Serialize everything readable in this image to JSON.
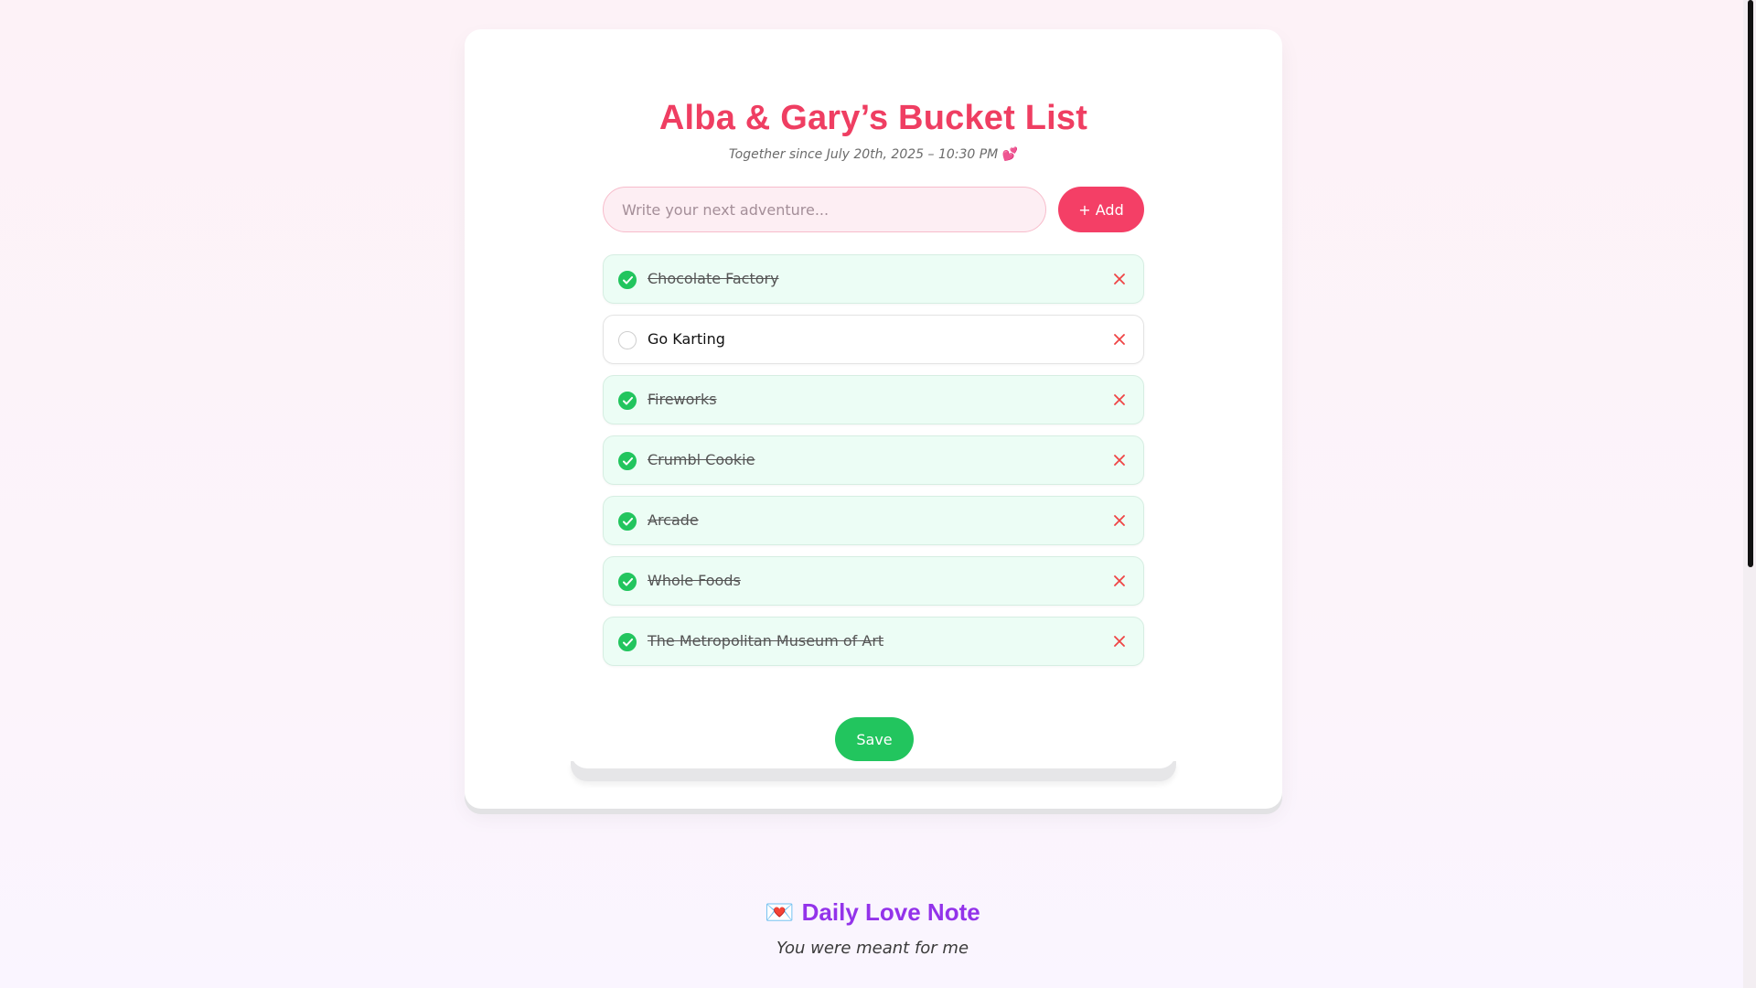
{
  "header": {
    "title": "Alba & Gary’s Bucket List",
    "subtitle": "Together since July 20th, 2025 – 10:30 PM",
    "subtitle_emoji": "💕"
  },
  "add_form": {
    "placeholder": "Write your next adventure...",
    "value": "",
    "add_label": "+ Add"
  },
  "items": [
    {
      "label": "Chocolate Factory",
      "done": true
    },
    {
      "label": "Go Karting",
      "done": false
    },
    {
      "label": "Fireworks",
      "done": true
    },
    {
      "label": "Crumbl Cookie",
      "done": true
    },
    {
      "label": "Arcade",
      "done": true
    },
    {
      "label": "Whole Foods",
      "done": true
    },
    {
      "label": "The Metropolitan Museum of Art",
      "done": true
    }
  ],
  "save_label": "Save",
  "love_note": {
    "emoji": "💌",
    "title": "Daily Love Note",
    "text": "You were meant for me"
  },
  "colors": {
    "accent": "#f43f66",
    "title": "#ef3e62",
    "done_bg": "#ecfdf5",
    "check": "#22c55e",
    "note_title": "#9333ea"
  },
  "icons": {
    "check": "check-circle-icon",
    "delete": "close-icon",
    "heart": "two-hearts-icon",
    "envelope": "love-letter-icon"
  }
}
